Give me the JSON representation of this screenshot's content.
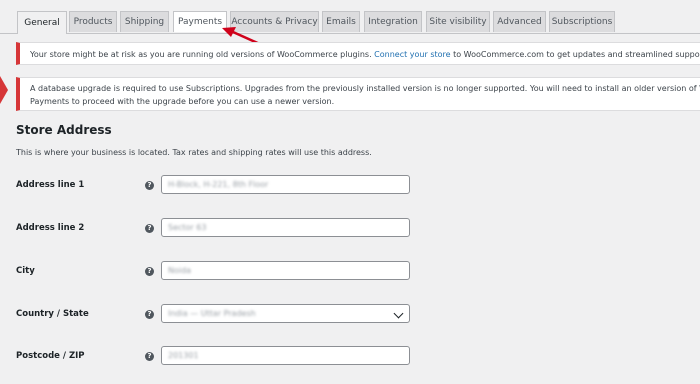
{
  "tabs": [
    {
      "label": "General",
      "active": true
    },
    {
      "label": "Products"
    },
    {
      "label": "Shipping"
    },
    {
      "label": "Payments"
    },
    {
      "label": "Accounts & Privacy"
    },
    {
      "label": "Emails"
    },
    {
      "label": "Integration"
    },
    {
      "label": "Site visibility"
    },
    {
      "label": "Advanced"
    },
    {
      "label": "Subscriptions"
    }
  ],
  "notices": {
    "outdated_plugins": {
      "text_before": "Your store might be at risk as you are running old versions of WooCommerce plugins. ",
      "link": "Connect your store",
      "text_after": " to WooCommerce.com to get updates and streamlined support for your subscripti"
    },
    "db_upgrade": {
      "line1": "A database upgrade is required to use Subscriptions. Upgrades from the previously installed version is no longer supported. You will need to install an older version of WooCommerce Subscr",
      "line2": "Payments to proceed with the upgrade before you can use a newer version."
    }
  },
  "section": {
    "title": "Store Address",
    "description": "This is where your business is located. Tax rates and shipping rates will use this address."
  },
  "fields": [
    {
      "label": "Address line 1",
      "value": "H-Block, H-221, 8th Floor",
      "help_icon": "?"
    },
    {
      "label": "Address line 2",
      "value": "Sector 63",
      "help_icon": "?"
    },
    {
      "label": "City",
      "value": "Noida",
      "help_icon": "?"
    },
    {
      "label": "Country / State",
      "value": "India — Uttar Pradesh",
      "help_icon": "?"
    },
    {
      "label": "Postcode / ZIP",
      "value": "201301",
      "help_icon": "?"
    }
  ],
  "colors": {
    "accent": "#2271b1",
    "notice_error": "#d63638",
    "annotation_arrow": "#d0021b"
  }
}
